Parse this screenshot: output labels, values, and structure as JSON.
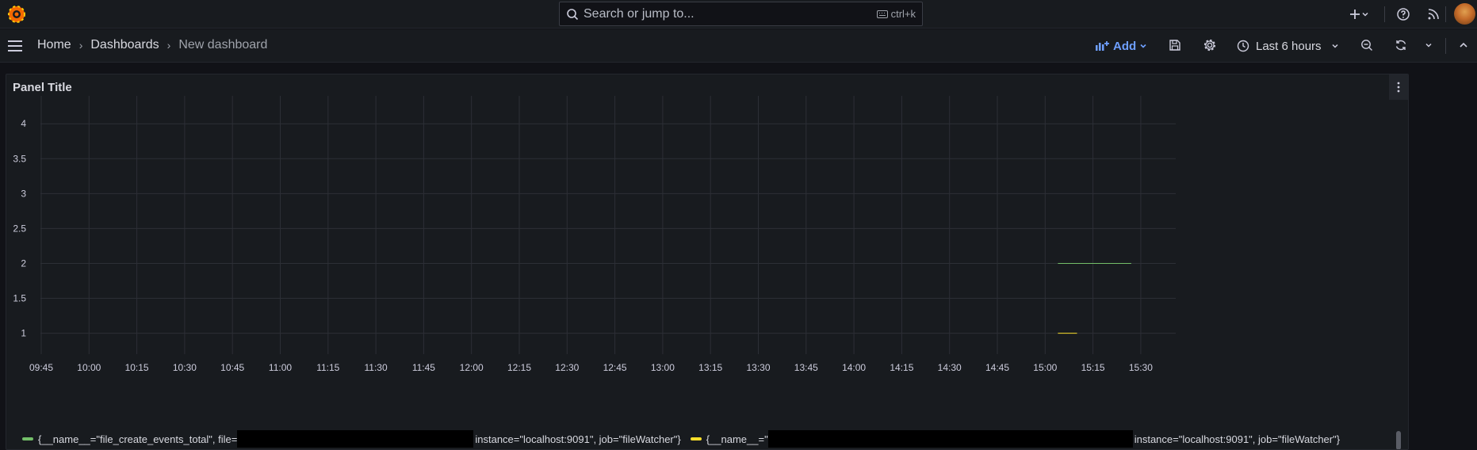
{
  "topbar": {
    "search_placeholder": "Search or jump to...",
    "search_shortcut": "ctrl+k",
    "icons": [
      "grafana-logo-icon",
      "search-icon",
      "keyboard-icon",
      "plus-icon",
      "chevron-down-icon",
      "help-icon",
      "news-rss-icon",
      "avatar"
    ]
  },
  "navbar": {
    "breadcrumbs": [
      "Home",
      "Dashboards",
      "New dashboard"
    ],
    "add_label": "Add",
    "time_range": "Last 6 hours",
    "accent_color": "#6e9fff"
  },
  "panel": {
    "title": "Panel Title"
  },
  "chart_data": {
    "type": "line",
    "title": "Panel Title",
    "x_ticks": [
      "09:45",
      "10:00",
      "10:15",
      "10:30",
      "10:45",
      "11:00",
      "11:15",
      "11:30",
      "11:45",
      "12:00",
      "12:15",
      "12:30",
      "12:45",
      "13:00",
      "13:15",
      "13:30",
      "13:45",
      "14:00",
      "14:15",
      "14:30",
      "14:45",
      "15:00",
      "15:15",
      "15:30"
    ],
    "y_ticks": [
      "1",
      "1.5",
      "2",
      "2.5",
      "3",
      "3.5",
      "4"
    ],
    "ylim": [
      0.7,
      4.4
    ],
    "grid": true,
    "legend_placement": "bottom",
    "series": [
      {
        "name": "{__name__=\"file_create_events_total\", file=",
        "name_suffix": "instance=\"localhost:9091\", job=\"fileWatcher\"}",
        "color": "#73bf69",
        "x": [
          "15:04",
          "15:27"
        ],
        "y": [
          2,
          2
        ]
      },
      {
        "name": "{__name__=\"",
        "name_suffix": "instance=\"localhost:9091\", job=\"fileWatcher\"}",
        "color": "#fade2a",
        "x": [
          "15:04",
          "15:10"
        ],
        "y": [
          1,
          1
        ]
      }
    ]
  }
}
